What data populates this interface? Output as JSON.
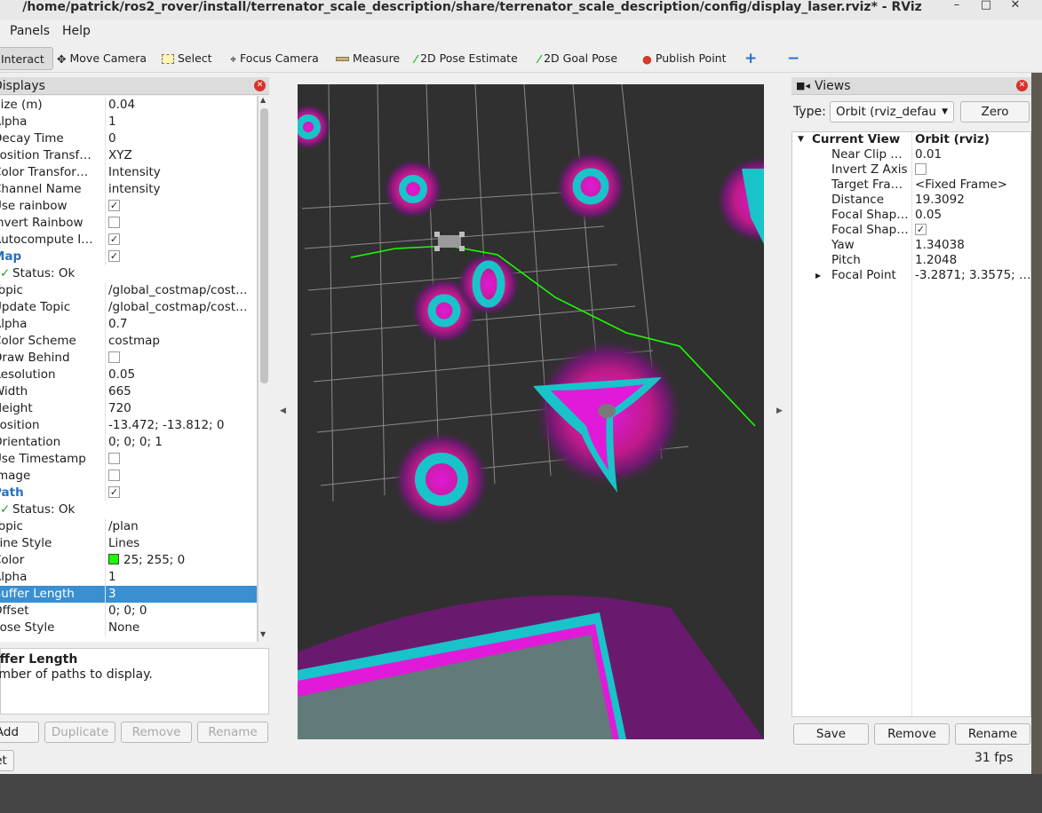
{
  "window": {
    "title": "/home/patrick/ros2_rover/install/terrenator_scale_description/share/terrenator_scale_description/config/display_laser.rviz* - RViz"
  },
  "menu": {
    "panels": "Panels",
    "help": "Help"
  },
  "toolbar": {
    "interact": "Interact",
    "move_camera": "Move Camera",
    "select": "Select",
    "focus_camera": "Focus Camera",
    "measure": "Measure",
    "pose_estimate": "2D Pose Estimate",
    "goal_pose": "2D Goal Pose",
    "publish_point": "Publish Point",
    "add_glyph": "+",
    "remove_glyph": "−"
  },
  "displays": {
    "title": "Displays",
    "rows": [
      {
        "k": "Size (m)",
        "v": "0.04"
      },
      {
        "k": "Alpha",
        "v": "1"
      },
      {
        "k": "Decay Time",
        "v": "0"
      },
      {
        "k": "Position Transf…",
        "v": "XYZ"
      },
      {
        "k": "Color Transfor…",
        "v": "Intensity"
      },
      {
        "k": "Channel Name",
        "v": "intensity"
      },
      {
        "k": "Use rainbow",
        "v": "✓"
      },
      {
        "k": "Invert Rainbow",
        "v": ""
      },
      {
        "k": "Autocompute I…",
        "v": "✓"
      },
      {
        "k": "Map",
        "v": "✓"
      },
      {
        "k": "Status: Ok",
        "v": ""
      },
      {
        "k": "Topic",
        "v": "/global_costmap/cost…"
      },
      {
        "k": "Update Topic",
        "v": "/global_costmap/cost…"
      },
      {
        "k": "Alpha",
        "v": "0.7"
      },
      {
        "k": "Color Scheme",
        "v": "costmap"
      },
      {
        "k": "Draw Behind",
        "v": ""
      },
      {
        "k": "Resolution",
        "v": "0.05"
      },
      {
        "k": "Width",
        "v": "665"
      },
      {
        "k": "Height",
        "v": "720"
      },
      {
        "k": "Position",
        "v": "-13.472; -13.812; 0"
      },
      {
        "k": "Orientation",
        "v": "0; 0; 0; 1"
      },
      {
        "k": "Use Timestamp",
        "v": ""
      },
      {
        "k": "Image",
        "v": ""
      },
      {
        "k": "Path",
        "v": "✓"
      },
      {
        "k": "Status: Ok",
        "v": ""
      },
      {
        "k": "Topic",
        "v": "/plan"
      },
      {
        "k": "Line Style",
        "v": "Lines"
      },
      {
        "k": "Color",
        "v": "25; 255; 0"
      },
      {
        "k": "Alpha",
        "v": "1"
      },
      {
        "k": "Buffer Length",
        "v": "3"
      },
      {
        "k": "Offset",
        "v": "0; 0; 0"
      },
      {
        "k": "Pose Style",
        "v": "None"
      }
    ],
    "desc_title": "Buffer Length",
    "desc_text": "Number of paths to display.",
    "buttons": {
      "add": "Add",
      "duplicate": "Duplicate",
      "remove": "Remove",
      "rename": "Rename",
      "reset": "Reset"
    }
  },
  "views": {
    "title": "Views",
    "type_label": "Type:",
    "type_value": "Orbit (rviz_default_plugins)",
    "zero": "Zero",
    "current_view": "Current View",
    "current_view_value": "Orbit (rviz)",
    "rows": [
      {
        "k": "Near Clip …",
        "v": "0.01"
      },
      {
        "k": "Invert Z Axis",
        "v": ""
      },
      {
        "k": "Target Fra…",
        "v": "<Fixed Frame>"
      },
      {
        "k": "Distance",
        "v": "19.3092"
      },
      {
        "k": "Focal Shap…",
        "v": "0.05"
      },
      {
        "k": "Focal Shap…",
        "v": "✓"
      },
      {
        "k": "Yaw",
        "v": "1.34038"
      },
      {
        "k": "Pitch",
        "v": "1.2048"
      },
      {
        "k": "Focal Point",
        "v": "-3.2871; 3.3575; …"
      }
    ],
    "buttons": {
      "save": "Save",
      "remove": "Remove",
      "rename": "Rename"
    }
  },
  "status": {
    "fps": "31 fps"
  },
  "colors": {
    "path": "#19ff00",
    "costmap_cyan": "#18c4c9",
    "costmap_magenta": "#e01ad8",
    "selection": "#3a8fd1"
  }
}
